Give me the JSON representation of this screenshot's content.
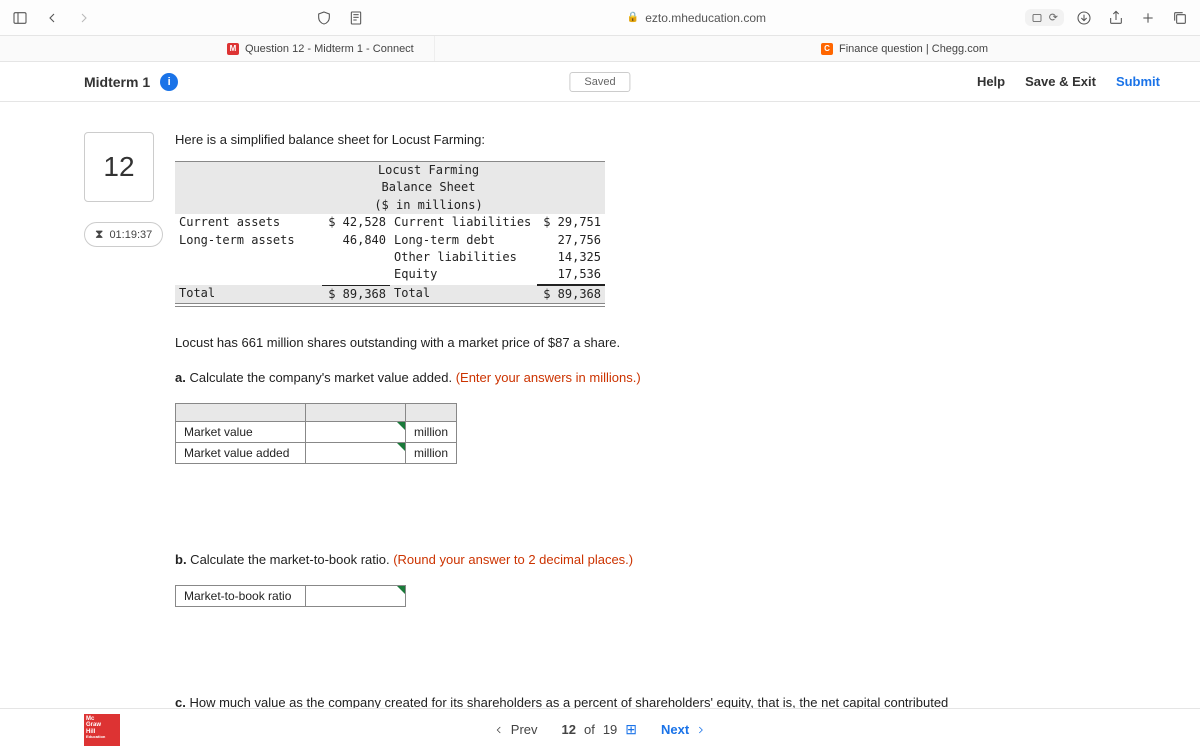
{
  "browser": {
    "url_host": "ezto.mheducation.com",
    "tab1": "Question 12 - Midterm 1 - Connect",
    "tab2": "Finance question | Chegg.com"
  },
  "header": {
    "title": "Midterm 1",
    "saved": "Saved",
    "help": "Help",
    "save_exit": "Save & Exit",
    "submit": "Submit"
  },
  "question": {
    "number": "12",
    "timer": "01:19:37",
    "intro": "Here is a simplified balance sheet for Locust Farming:"
  },
  "sheet": {
    "company": "Locust Farming",
    "title2": "Balance Sheet",
    "units": "($ in millions)",
    "left": {
      "r1_label": "Current assets",
      "r1_val": "$ 42,528",
      "r2_label": "Long-term assets",
      "r2_val": "46,840",
      "tot_label": "Total",
      "tot_val": "$ 89,368"
    },
    "right": {
      "r1_label": "Current liabilities",
      "r1_val": "$ 29,751",
      "r2_label": "Long-term debt",
      "r2_val": "27,756",
      "r3_label": "Other liabilities",
      "r3_val": "14,325",
      "r4_label": "Equity",
      "r4_val": "17,536",
      "tot_label": "Total",
      "tot_val": "$ 89,368"
    }
  },
  "body": {
    "shares_line": "Locust has 661 million shares outstanding with a market price of $87 a share.",
    "a_prefix": "a.",
    "a_text": " Calculate the company's market value added. ",
    "a_red": "(Enter your answers in millions.)",
    "table_a": {
      "row1_label": "Market value",
      "row1_unit": "million",
      "row2_label": "Market value added",
      "row2_unit": "million"
    },
    "b_prefix": "b.",
    "b_text": " Calculate the market-to-book ratio. ",
    "b_red": "(Round your answer to 2 decimal places.)",
    "table_b": {
      "row1_label": "Market-to-book ratio"
    },
    "c_prefix": "c.",
    "c_text": " How much value as the company created for its shareholders as a percent of shareholders' equity, that is, the net capital contributed"
  },
  "footer": {
    "logo_l1": "Mc",
    "logo_l2": "Graw",
    "logo_l3": "Hill",
    "logo_l4": "Education",
    "prev": "Prev",
    "pos_num": "12",
    "pos_of": "of",
    "pos_total": "19",
    "next": "Next"
  }
}
